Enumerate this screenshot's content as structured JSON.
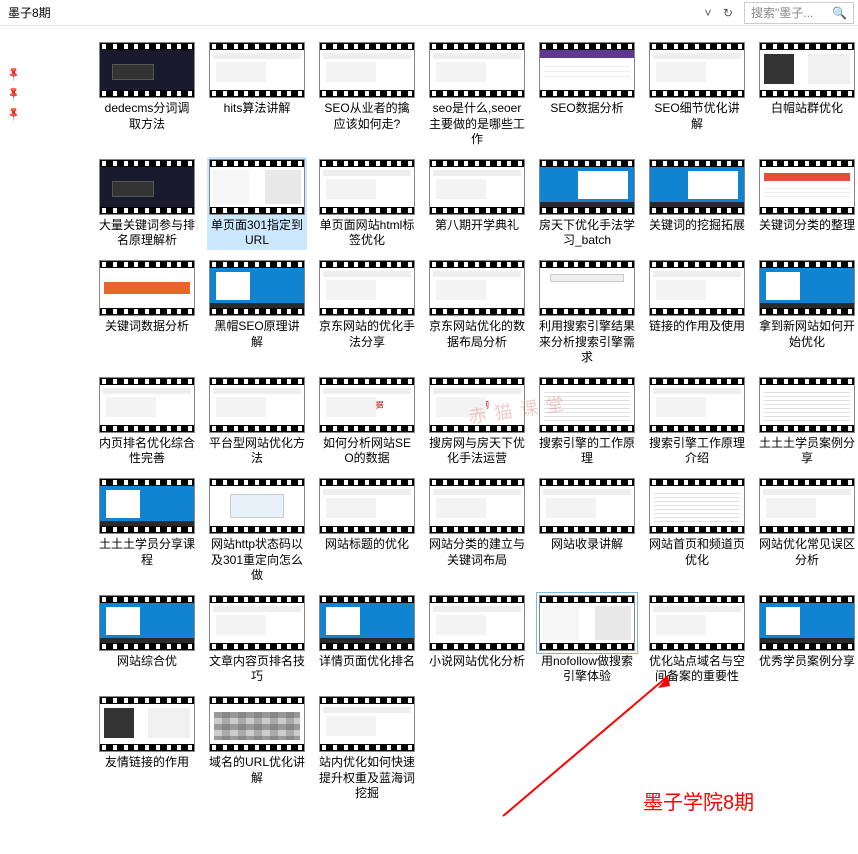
{
  "header": {
    "title": "墨子8期",
    "search_placeholder": "搜索\"墨子... "
  },
  "sidebar": {
    "pins": [
      "📌",
      "📌",
      "📌"
    ]
  },
  "annotation": {
    "text": "墨子学院8期"
  },
  "watermark": "赤猫课堂",
  "items": [
    {
      "label": "dedecms分词调取方法",
      "screen": "sc-dark"
    },
    {
      "label": "hits算法讲解",
      "screen": "sc-light"
    },
    {
      "label": "SEO从业者的擒应该如何走?",
      "screen": "sc-light"
    },
    {
      "label": "seo是什么,seoer主要做的是哪些工作",
      "screen": "sc-light"
    },
    {
      "label": "SEO数据分析",
      "screen": "sc-purple"
    },
    {
      "label": "SEO细节优化讲解",
      "screen": "sc-light"
    },
    {
      "label": "白帽站群优化",
      "screen": "sc-mix"
    },
    {
      "label": "大量关键词参与排名原理解析",
      "screen": "sc-dark"
    },
    {
      "label": "单页面301指定到URL",
      "screen": "sc-split",
      "selected": true
    },
    {
      "label": "单页面网站html标签优化",
      "screen": "sc-light"
    },
    {
      "label": "第八期开学典礼",
      "screen": "sc-light"
    },
    {
      "label": "房天下优化手法学习_batch",
      "screen": "sc-desktop sc-desktop-r"
    },
    {
      "label": "关键词的挖掘拓展",
      "screen": "sc-desktop sc-desktop-r"
    },
    {
      "label": "关键词分类的整理",
      "screen": "sc-table"
    },
    {
      "label": "关键词数据分析",
      "screen": "sc-orange"
    },
    {
      "label": "黑帽SEO原理讲解",
      "screen": "sc-desktop"
    },
    {
      "label": "京东网站的优化手法分享",
      "screen": "sc-light"
    },
    {
      "label": "京东网站优化的数据布局分析",
      "screen": "sc-light"
    },
    {
      "label": "利用搜索引擎结果来分析搜索引擎需求",
      "screen": "sc-search"
    },
    {
      "label": "链接的作用及使用",
      "screen": "sc-light"
    },
    {
      "label": "拿到新网站如何开始优化",
      "screen": "sc-desktop"
    },
    {
      "label": "内页排名优化综合性完善",
      "screen": "sc-light"
    },
    {
      "label": "平台型网站优化方法",
      "screen": "sc-light"
    },
    {
      "label": "如何分析网站SEO的数据",
      "screen": "sc-light",
      "redtxt": "SEO数据"
    },
    {
      "label": "搜房网与房天下优化手法运营",
      "screen": "sc-light",
      "redtxt": "搜房网"
    },
    {
      "label": "搜索引擎的工作原理",
      "screen": "sc-text"
    },
    {
      "label": "搜索引擎工作原理介绍",
      "screen": "sc-light"
    },
    {
      "label": "土土土学员案例分享",
      "screen": "sc-text"
    },
    {
      "label": "土土土学员分享课程",
      "screen": "sc-desktop"
    },
    {
      "label": "网站http状态码以及301重定向怎么做",
      "screen": "sc-card"
    },
    {
      "label": "网站标题的优化",
      "screen": "sc-light"
    },
    {
      "label": "网站分类的建立与关键词布局",
      "screen": "sc-light"
    },
    {
      "label": "网站收录讲解",
      "screen": "sc-light"
    },
    {
      "label": "网站首页和频道页优化",
      "screen": "sc-text"
    },
    {
      "label": "网站优化常见误区分析",
      "screen": "sc-light"
    },
    {
      "label": "网站综合优",
      "screen": "sc-desktop"
    },
    {
      "label": "文章内容页排名技巧",
      "screen": "sc-light"
    },
    {
      "label": "详情页面优化排名",
      "screen": "sc-desktop"
    },
    {
      "label": "小说网站优化分析",
      "screen": "sc-light"
    },
    {
      "label": "用nofollow做搜索引擎体验",
      "screen": "sc-split",
      "highlighted": true
    },
    {
      "label": "优化站点域名与空间备案的重要性",
      "screen": "sc-light"
    },
    {
      "label": "优秀学员案例分享",
      "screen": "sc-desktop"
    },
    {
      "label": "友情链接的作用",
      "screen": "sc-mix"
    },
    {
      "label": "域名的URL优化讲解",
      "screen": "sc-grid"
    },
    {
      "label": "站内优化如何快速提升权重及蓝海词挖掘",
      "screen": "sc-light"
    }
  ]
}
